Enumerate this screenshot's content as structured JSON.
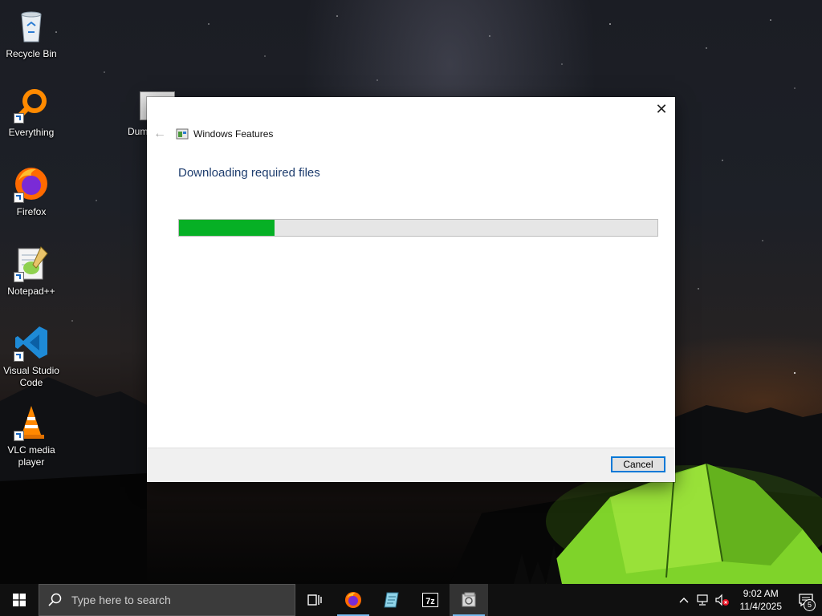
{
  "desktop": {
    "icons": [
      {
        "label": "Recycle Bin",
        "icon": "recycle-bin-icon"
      },
      {
        "label": "Everything",
        "icon": "everything-search-icon"
      },
      {
        "label": "Firefox",
        "icon": "firefox-icon"
      },
      {
        "label": "Notepad++",
        "icon": "notepad-plus-plus-icon"
      },
      {
        "label": "Visual Studio Code",
        "icon": "vscode-icon"
      },
      {
        "label": "VLC media player",
        "icon": "vlc-icon"
      }
    ],
    "partial_icon_label": "Dum"
  },
  "dialog": {
    "title": "Windows Features",
    "heading": "Downloading required files",
    "progress_fraction": 0.2,
    "cancel_label": "Cancel",
    "close_symbol": "✕",
    "back_symbol": "←"
  },
  "taskbar": {
    "search_placeholder": "Type here to search",
    "apps": [
      "task-view-icon",
      "firefox-icon",
      "notepad-icon",
      "7zip-icon",
      "windows-features-icon"
    ],
    "active_app": "windows-features-icon",
    "clock_time": "9:02 AM",
    "clock_date": "11/4/2025",
    "notification_count": "5"
  },
  "colors": {
    "accent": "#0078d7",
    "progress_green": "#06b025",
    "heading_blue": "#1e3d6e"
  }
}
